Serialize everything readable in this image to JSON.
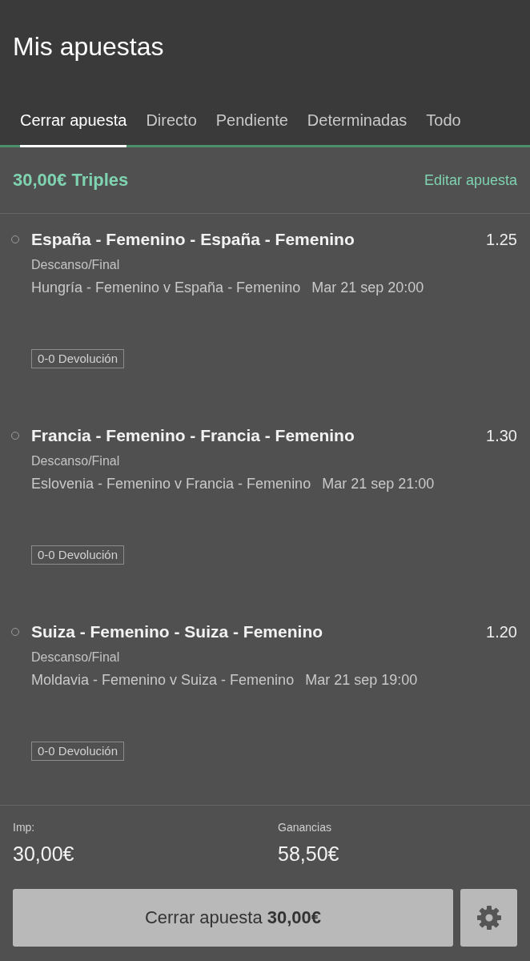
{
  "header": {
    "title": "Mis apuestas"
  },
  "tabs": [
    {
      "label": "Cerrar apuesta",
      "selected": true
    },
    {
      "label": "Directo",
      "selected": false
    },
    {
      "label": "Pendiente",
      "selected": false
    },
    {
      "label": "Determinadas",
      "selected": false
    },
    {
      "label": "Todo",
      "selected": false
    }
  ],
  "bet": {
    "title": "30,00€ Triples",
    "edit_link": "Editar apuesta"
  },
  "selections": [
    {
      "pick": "España - Femenino - España - Femenino",
      "odds": "1.25",
      "market": "Descanso/Final",
      "event": "Hungría - Femenino v España - Femenino",
      "time": "Mar 21 sep 20:00",
      "tag": "0-0 Devolución"
    },
    {
      "pick": "Francia - Femenino - Francia - Femenino",
      "odds": "1.30",
      "market": "Descanso/Final",
      "event": "Eslovenia - Femenino v Francia - Femenino",
      "time": "Mar 21 sep 21:00",
      "tag": "0-0 Devolución"
    },
    {
      "pick": "Suiza - Femenino - Suiza - Femenino",
      "odds": "1.20",
      "market": "Descanso/Final",
      "event": "Moldavia - Femenino v Suiza - Femenino",
      "time": "Mar 21 sep 19:00",
      "tag": "0-0 Devolución"
    }
  ],
  "summary": {
    "stake_label": "Imp:",
    "stake": "30,00€",
    "returns_label": "Ganancias",
    "returns": "58,50€"
  },
  "cash_out_button": "Cerrar apuesta **30,00€**"
}
